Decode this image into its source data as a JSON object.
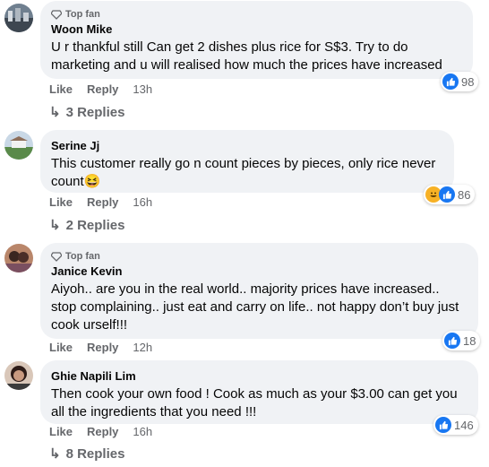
{
  "actions": {
    "like_label": "Like",
    "reply_label": "Reply"
  },
  "colors": {
    "bubble": "#f0f2f5",
    "like_blue": "#1877f2",
    "meta_gray": "#65676b"
  },
  "comments": [
    {
      "badge": "Top fan",
      "author": "Woon Mike",
      "text": "U r thankful still Can get 2 dishes plus rice for S$3. Try to do marketing and u will realised how much the prices have increased",
      "time": "13h",
      "reaction_count": "98",
      "replies": "3 Replies"
    },
    {
      "badge": "",
      "author": "Serine Jj",
      "text": "This customer really go n count pieces by pieces, only rice never count",
      "time": "16h",
      "reaction_count": "86",
      "replies": "2 Replies"
    },
    {
      "badge": "Top fan",
      "author": "Janice Kevin",
      "text": "Aiyoh.. are you in the real world.. majority prices have increased.. stop complaining.. just eat and carry on life.. not happy don’t buy just cook urself!!!",
      "time": "12h",
      "reaction_count": "18",
      "replies": ""
    },
    {
      "badge": "",
      "author": "Ghie Napili Lim",
      "text": "Then cook your own food ! Cook as much as your $3.00 can get you all the ingredients that you need !!!",
      "time": "16h",
      "reaction_count": "146",
      "replies": "8 Replies"
    }
  ]
}
